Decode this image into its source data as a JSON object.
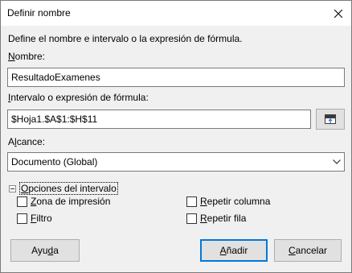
{
  "window": {
    "title": "Definir nombre"
  },
  "description": "Define el nombre e intervalo o la expresión de fórmula.",
  "name_field": {
    "label_hotkey": "N",
    "label_rest": "ombre:",
    "value": "ResultadoExamenes"
  },
  "range_field": {
    "label_hotkey": "I",
    "label_rest": "ntervalo o expresión de fórmula:",
    "value": "$Hoja1.$A$1:$H$11"
  },
  "scope": {
    "label_pre": "A",
    "label_hotkey": "l",
    "label_rest": "cance:",
    "selected": "Documento (Global)"
  },
  "range_options": {
    "label_hotkey": "O",
    "label_rest": "pciones del intervalo",
    "print_range": {
      "hotkey": "Z",
      "rest": "ona de impresión",
      "checked": false
    },
    "filter": {
      "hotkey": "F",
      "rest": "iltro",
      "checked": false
    },
    "repeat_column": {
      "hotkey": "R",
      "rest": "epetir columna",
      "checked": false
    },
    "repeat_row": {
      "hotkey": "R",
      "rest": "epetir fila",
      "checked": false
    }
  },
  "buttons": {
    "help": {
      "pre": "Ayu",
      "hotkey": "d",
      "rest": "a"
    },
    "add": {
      "pre": "",
      "hotkey": "A",
      "rest": "ñadir"
    },
    "cancel": {
      "pre": "",
      "hotkey": "C",
      "rest": "ancelar"
    }
  },
  "colors": {
    "default_button_border": "#0078d7",
    "dialog_bg": "#f0f0f0"
  }
}
